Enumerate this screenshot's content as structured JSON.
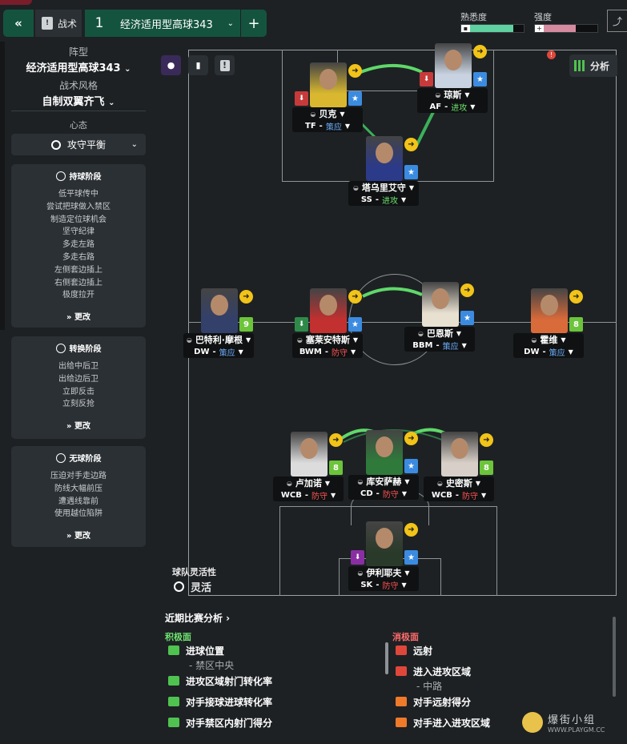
{
  "topbar": {
    "back_icon": "«",
    "tactics_label": "战术",
    "slot_number": "1",
    "slot_name": "经济适用型高球343",
    "add_icon": "+",
    "familiarity_label": "熟悉度",
    "intensity_label": "强度",
    "familiarity_level": 0.8,
    "intensity_level": 0.6,
    "familiarity_color": "#5fd0a0",
    "intensity_color": "#d68aa0"
  },
  "sidebar": {
    "formation_label": "阵型",
    "formation_value": "经济适用型高球343",
    "style_label": "战术风格",
    "style_value": "自制双翼齐飞",
    "mentality_label": "心态",
    "mentality_value": "攻守平衡",
    "in_possession": {
      "title": "持球阶段",
      "items": [
        "低平球传中",
        "尝试把球做入禁区",
        "制造定位球机会",
        "坚守纪律",
        "多走左路",
        "多走右路",
        "左侧套边插上",
        "右侧套边插上",
        "极度拉开"
      ],
      "edit": "更改"
    },
    "transition": {
      "title": "转换阶段",
      "items": [
        "出给中后卫",
        "出给边后卫",
        "立即反击",
        "立刻反抢"
      ],
      "edit": "更改"
    },
    "out_possession": {
      "title": "无球阶段",
      "items": [
        "压迫对手走边路",
        "防线大幅前压",
        "遭遇线靠前",
        "使用越位陷阱"
      ],
      "edit": "更改"
    }
  },
  "pitch": {
    "analysis_button": "分析",
    "flexibility_label": "球队灵活性",
    "flexibility_value": "灵活",
    "players": [
      {
        "id": "bk",
        "name": "贝克",
        "pos": "TF",
        "duty": "策应",
        "duty_type": "s",
        "badge": "★",
        "trait_color": "red"
      },
      {
        "id": "jones",
        "name": "琼斯",
        "pos": "AF",
        "duty": "进攻",
        "duty_type": "a",
        "badge": "★",
        "trait_color": "red"
      },
      {
        "id": "taw",
        "name": "塔乌里艾守",
        "pos": "SS",
        "duty": "进攻",
        "duty_type": "a",
        "badge": "★",
        "trait_color": ""
      },
      {
        "id": "bm",
        "name": "巴特利·摩根",
        "pos": "DW",
        "duty": "策应",
        "duty_type": "s",
        "badge": "9",
        "trait_color": ""
      },
      {
        "id": "sai",
        "name": "塞莱安特斯",
        "pos": "BWM",
        "duty": "防守",
        "duty_type": "d",
        "badge": "★",
        "trait_color": "green"
      },
      {
        "id": "barns",
        "name": "巴恩斯",
        "pos": "BBM",
        "duty": "策应",
        "duty_type": "s",
        "badge": "★",
        "trait_color": ""
      },
      {
        "id": "hw",
        "name": "霍维",
        "pos": "DW",
        "duty": "策应",
        "duty_type": "s",
        "badge": "8",
        "trait_color": ""
      },
      {
        "id": "lu",
        "name": "卢加诺",
        "pos": "WCB",
        "duty": "防守",
        "duty_type": "d",
        "badge": "8",
        "trait_color": ""
      },
      {
        "id": "ku",
        "name": "库安萨赫",
        "pos": "CD",
        "duty": "防守",
        "duty_type": "d",
        "badge": "★",
        "trait_color": ""
      },
      {
        "id": "sm",
        "name": "史密斯",
        "pos": "WCB",
        "duty": "防守",
        "duty_type": "d",
        "badge": "8",
        "trait_color": ""
      },
      {
        "id": "il",
        "name": "伊利耶夫",
        "pos": "SK",
        "duty": "防守",
        "duty_type": "d",
        "badge": "★",
        "trait_color": "purple"
      }
    ]
  },
  "analysis": {
    "title": "近期比赛分析 ›",
    "positive_label": "积极面",
    "negative_label": "消极面",
    "positives": [
      {
        "text": "进球位置",
        "sub": "- 禁区中央"
      },
      {
        "text": "进攻区域射门转化率",
        "sub": ""
      },
      {
        "text": "对手接球进球转化率",
        "sub": ""
      },
      {
        "text": "对手禁区内射门得分",
        "sub": ""
      }
    ],
    "negatives": [
      {
        "text": "远射",
        "sub": ""
      },
      {
        "text": "进入进攻区域",
        "sub": "- 中路"
      },
      {
        "text": "对手远射得分",
        "sub": ""
      },
      {
        "text": "对手进入进攻区域",
        "sub": ""
      }
    ]
  },
  "watermark": {
    "text": "爆街小组",
    "url": "WWW.PLAYGM.CC"
  }
}
